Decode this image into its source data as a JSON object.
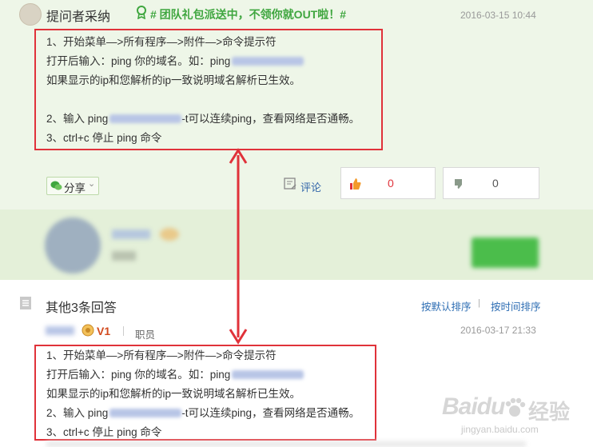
{
  "question": {
    "asker_label": "提问者采纳",
    "promo_text": "# 团队礼包派送中，不领你就OUT啦！#",
    "timestamp": "2016-03-15 10:44",
    "answer_lines": [
      "1、开始菜单—>所有程序—>附件—>命令提示符",
      "打开后输入：ping 你的域名。如：ping",
      "如果显示的ip和您解析的ip一致说明域名解析已生效。",
      "",
      "2、输入 ping",
      "3、ctrl+c 停止 ping 命令"
    ],
    "line5_suffix": "-t可以连续ping，查看网络是否通畅。",
    "share_label": "分享",
    "comment_label": "评论",
    "upvote_count": "0",
    "downvote_count": "0"
  },
  "other_answers": {
    "heading": "其他3条回答",
    "sort_default": "按默认排序",
    "sort_time": "按时间排序",
    "sort_separator": "|",
    "user_level": "V1",
    "user_role": "职员",
    "timestamp": "2016-03-17 21:33",
    "answer_lines": [
      "1、开始菜单—>所有程序—>附件—>命令提示符",
      "打开后输入：ping 你的域名。如：ping",
      "如果显示的ip和您解析的ip一致说明域名解析已生效。",
      "2、输入 ping",
      "3、ctrl+c 停止 ping 命令"
    ],
    "line4_suffix": "-t可以连续ping，查看网络是否通畅。"
  },
  "watermark": {
    "brand": "Baidu",
    "suffix": "经验",
    "url": "jingyan.baidu.com"
  },
  "colors": {
    "accent_green": "#3fa63f",
    "annotation_red": "#e0323a",
    "link_blue": "#2d6db3",
    "upvote_red": "#e0323a"
  }
}
